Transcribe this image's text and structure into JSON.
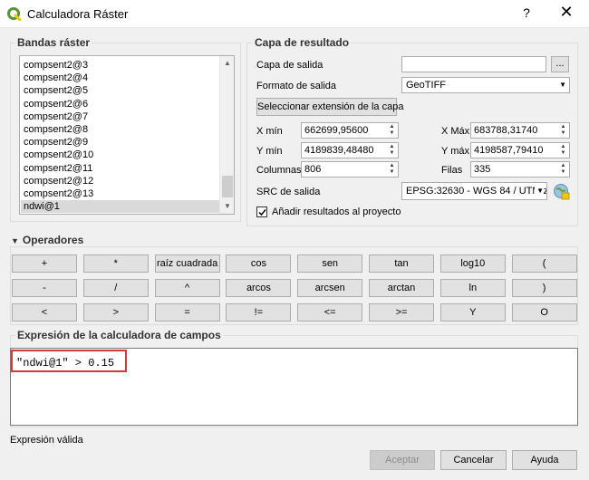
{
  "window": {
    "title": "Calculadora Ráster",
    "help": "?",
    "close": "✕"
  },
  "bands": {
    "group_title": "Bandas ráster",
    "items": [
      "compsent2@3",
      "compsent2@4",
      "compsent2@5",
      "compsent2@6",
      "compsent2@7",
      "compsent2@8",
      "compsent2@9",
      "compsent2@10",
      "compsent2@11",
      "compsent2@12",
      "compsent2@13",
      "ndwi@1"
    ],
    "selected_index": 11
  },
  "result": {
    "group_title": "Capa de resultado",
    "output_layer_label": "Capa de salida",
    "output_layer_value": "",
    "browse_label": "...",
    "format_label": "Formato de salida",
    "format_value": "GeoTIFF",
    "extent_button": "Seleccionar extensión de la capa",
    "xmin_label": "X mín",
    "xmin_value": "662699,95600",
    "xmax_label": "X Máx",
    "xmax_value": "683788,31740",
    "ymin_label": "Y mín",
    "ymin_value": "4189839,48480",
    "ymax_label": "Y máx",
    "ymax_value": "4198587,79410",
    "columns_label": "Columnas",
    "columns_value": "806",
    "rows_label": "Filas",
    "rows_value": "335",
    "crs_label": "SRC de salida",
    "crs_value": "EPSG:32630 - WGS 84 / UTM z",
    "add_result_label": "Añadir resultados al proyecto",
    "add_result_checked": true
  },
  "operators": {
    "title": "Operadores",
    "rows": [
      [
        "+",
        "*",
        "raíz cuadrada",
        "cos",
        "sen",
        "tan",
        "log10",
        "("
      ],
      [
        "-",
        "/",
        "^",
        "arcos",
        "arcsen",
        "arctan",
        "ln",
        ")"
      ],
      [
        "<",
        ">",
        "=",
        "!=",
        "<=",
        ">=",
        "Y",
        "O"
      ]
    ]
  },
  "expression": {
    "group_title": "Expresión de la calculadora de campos",
    "value": "\"ndwi@1\" > 0.15",
    "status": "Expresión válida"
  },
  "buttons": {
    "accept": "Aceptar",
    "cancel": "Cancelar",
    "help": "Ayuda"
  },
  "colors": {
    "accent": "#d43a3a",
    "qgis_green": "#589632",
    "qgis_yellow": "#eec90d"
  }
}
